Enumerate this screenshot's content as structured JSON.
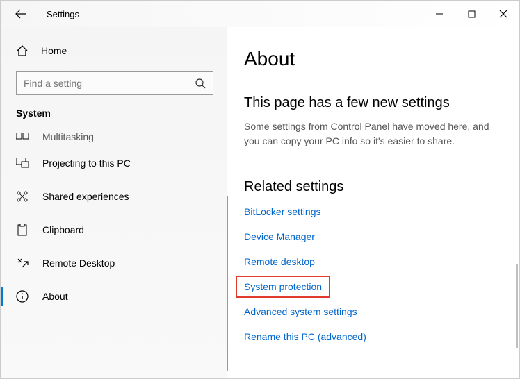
{
  "window": {
    "title": "Settings"
  },
  "sidebar": {
    "home": "Home",
    "search_placeholder": "Find a setting",
    "section": "System",
    "items": [
      {
        "label": "Multitasking"
      },
      {
        "label": "Projecting to this PC"
      },
      {
        "label": "Shared experiences"
      },
      {
        "label": "Clipboard"
      },
      {
        "label": "Remote Desktop"
      },
      {
        "label": "About"
      }
    ]
  },
  "main": {
    "title": "About",
    "subheading": "This page has a few new settings",
    "description": "Some settings from Control Panel have moved here, and you can copy your PC info so it's easier to share.",
    "related_heading": "Related settings",
    "links": [
      "BitLocker settings",
      "Device Manager",
      "Remote desktop",
      "System protection",
      "Advanced system settings",
      "Rename this PC (advanced)"
    ]
  }
}
